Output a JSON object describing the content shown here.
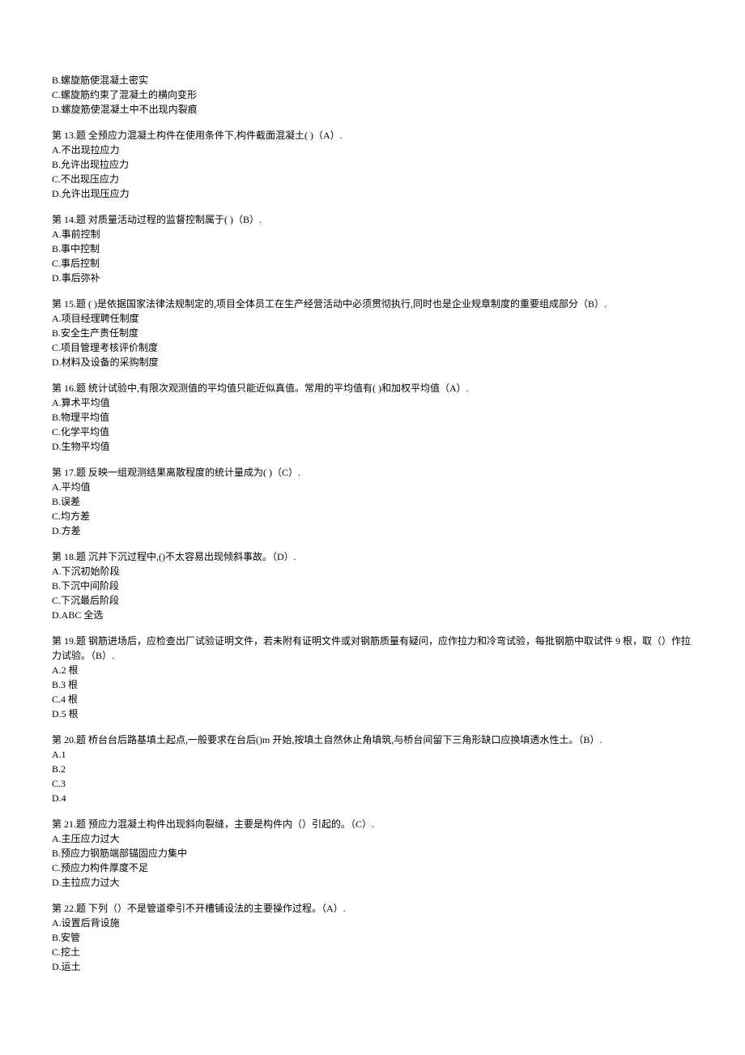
{
  "orphan_options": [
    "B.螺旋筋使混凝土密实",
    "C.螺旋筋约束了混凝土的横向变形",
    "D.螺旋筋使混凝土中不出现内裂痕"
  ],
  "questions": [
    {
      "stem": "第 13.题     全预应力混凝土构件在使用条件下,构件截面混凝土( )（A）.",
      "options": [
        "A.不出现拉应力",
        "B.允许出现拉应力",
        "C.不出现压应力",
        "D.允许出现压应力"
      ]
    },
    {
      "stem": "第 14.题     对质量活动过程的监督控制属于( )（B）.",
      "options": [
        "A.事前控制",
        "B.事中控制",
        "C.事后控制",
        "D.事后弥补"
      ]
    },
    {
      "stem": "第 15.题    ( )是依据国家法律法规制定的,项目全体员工在生产经营活动中必须贯彻执行,同时也是企业规章制度的重要组成部分（B）.",
      "options": [
        "A.项目经理聘任制度",
        "B.安全生产责任制度",
        "C.项目管理考核评价制度",
        "D.材料及设备的采购制度"
      ]
    },
    {
      "stem": "第 16.题     统计试验中,有限次观测值的平均值只能近似真值。常用的平均值有( )和加权平均值（A）.",
      "options": [
        "A.算术平均值",
        "B.物理平均值",
        "C.化学平均值",
        "D.生物平均值"
      ]
    },
    {
      "stem": "第 17.题     反映一组观测结果离散程度的统计量成为( )（C）.",
      "options": [
        "A.平均值",
        "B.误差",
        "C.均方差",
        "D.方差"
      ]
    },
    {
      "stem": "第 18.题     沉井下沉过程中,()不太容易出现倾斜事故。（D）.",
      "options": [
        "A.下沉初始阶段",
        "B.下沉中间阶段",
        "C.下沉最后阶段",
        "D.ABC 全选"
      ]
    },
    {
      "stem": "第 19.题    钢筋进场后，应检查出厂试验证明文件，若未附有证明文件或对钢筋质量有疑问，应作拉力和冷弯试验，每批钢筋中取试件 9 根，取（）作拉力试验。（B）.",
      "options": [
        "A.2 根",
        "B.3 根",
        "C.4 根",
        "D.5 根"
      ]
    },
    {
      "stem": "第 20.题     桥台台后路基填土起点,一般要求在台后()m 开始,按填土自然休止角填筑,与桥台间留下三角形缺口应换填透水性土。（B）.",
      "options": [
        "A.1",
        "B.2",
        "C.3",
        "D.4"
      ]
    },
    {
      "stem": "第 21.题    预应力混凝土构件出现斜向裂缝，主要是构件内（）引起的。（C）.",
      "options": [
        "A.主压应力过大",
        "B.预应力钢筋端部锚固应力集中",
        "C.预应力构件厚度不足",
        "D.主拉应力过大"
      ]
    },
    {
      "stem": "第 22.题    下列（）不是管道牵引不开槽铺设法的主要操作过程。（A）.",
      "options": [
        "A.设置后背设施",
        "B.安管",
        "C.挖土",
        "D.运土"
      ]
    }
  ]
}
